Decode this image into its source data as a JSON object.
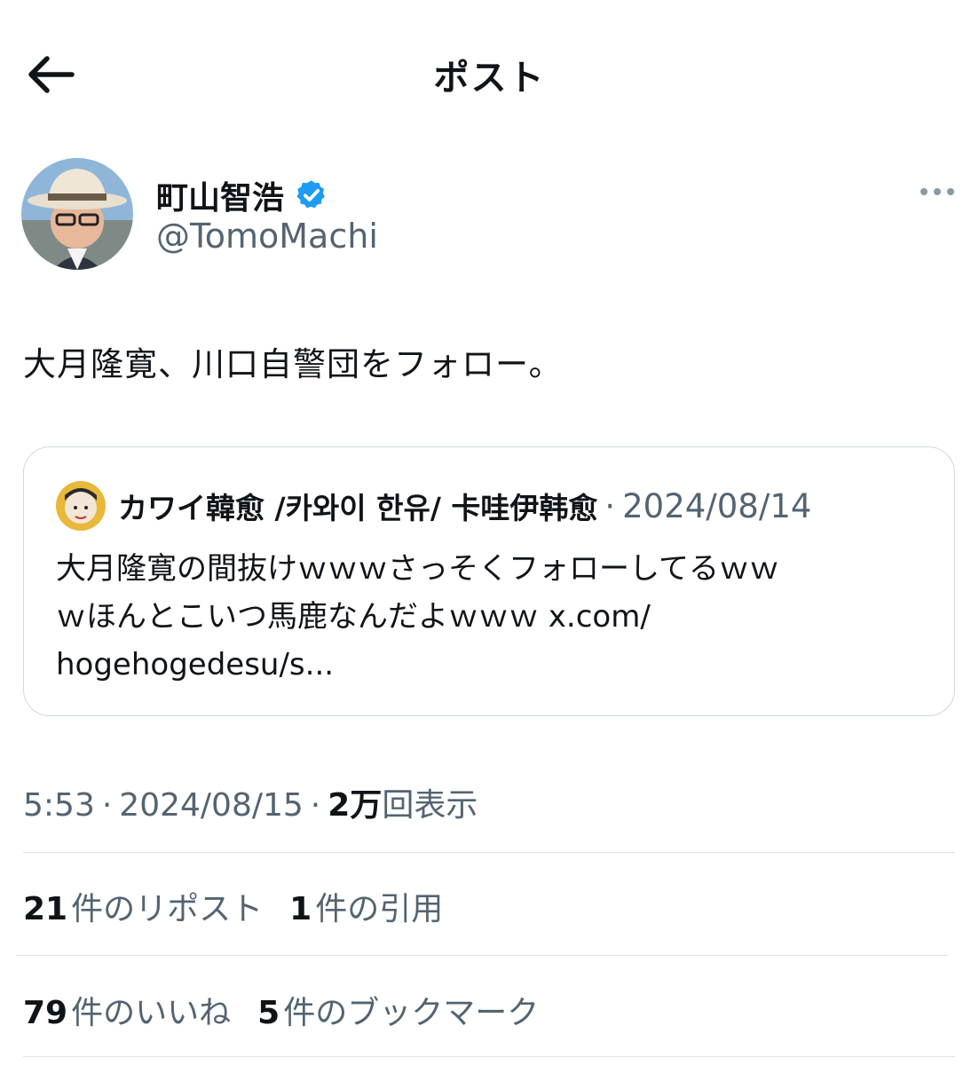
{
  "header": {
    "title": "ポスト",
    "back_icon": "arrow-left-icon"
  },
  "author": {
    "display_name": "町山智浩",
    "handle": "@TomoMachi",
    "verified_color": "#1d9bf0"
  },
  "post": {
    "text": "大月隆寛、川口自警団をフォロー。"
  },
  "quote": {
    "name": "カワイ韓愈 /카와이 한유/ 卡哇伊韩愈",
    "separator": "·",
    "date": "2024/08/14",
    "lines": [
      "大月隆寛の間抜けｗｗｗさっそくフォローしてるｗｗ",
      "ｗほんとこいつ馬鹿なんだよｗｗｗ x.com/",
      "hogehogedesu/s..."
    ]
  },
  "meta": {
    "time": "5:53",
    "sep": "·",
    "date": "2024/08/15",
    "views_num": "2",
    "views_unit": "万",
    "views_label": "回表示"
  },
  "stats_row1": [
    {
      "num": "21",
      "label": "件のリポスト"
    },
    {
      "num": "1",
      "label": "件の引用"
    }
  ],
  "stats_row2": [
    {
      "num": "79",
      "label": "件のいいね"
    },
    {
      "num": "5",
      "label": "件のブックマーク"
    }
  ],
  "colors": {
    "text": "#0f1419",
    "secondary": "#536471",
    "border": "#cfd9de",
    "accent": "#1d9bf0"
  }
}
